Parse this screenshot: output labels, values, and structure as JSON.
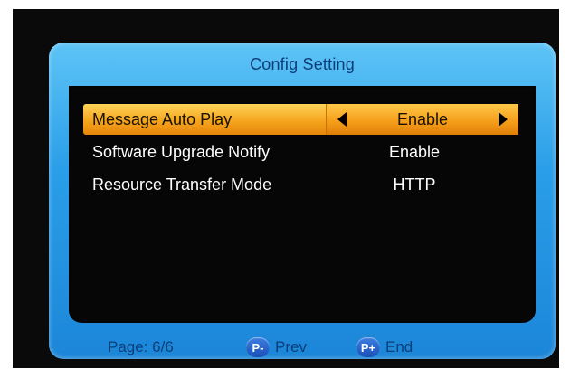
{
  "title": "Config Setting",
  "rows": [
    {
      "label": "Message Auto Play",
      "value": "Enable",
      "selected": true
    },
    {
      "label": "Software Upgrade Notify",
      "value": "Enable",
      "selected": false
    },
    {
      "label": "Resource Transfer Mode",
      "value": "HTTP",
      "selected": false
    }
  ],
  "footer": {
    "page": "Page: 6/6",
    "prev_key": "P-",
    "prev_label": "Prev",
    "end_key": "P+",
    "end_label": "End"
  },
  "colors": {
    "frame_blue": "#2a9ee8",
    "highlight_orange": "#f5a51e",
    "title_text": "#0b3e78"
  },
  "icons": {
    "left_arrow": "triangle-left-icon",
    "right_arrow": "triangle-right-icon"
  }
}
